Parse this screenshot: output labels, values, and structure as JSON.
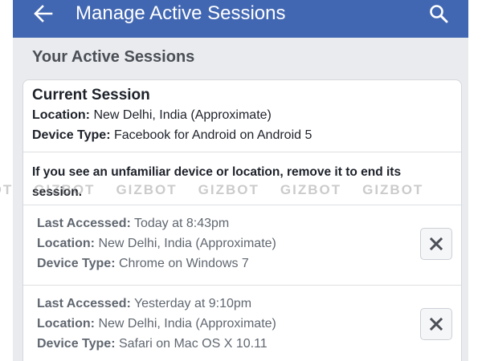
{
  "app_bar": {
    "title": "Manage Active Sessions",
    "back_icon": "arrow-left-icon",
    "search_icon": "search-icon",
    "color": "#4267b2"
  },
  "section_heading": "Your Active Sessions",
  "current_session": {
    "title": "Current Session",
    "location_label": "Location:",
    "location_value": "New Delhi, India (Approximate)",
    "device_label": "Device Type:",
    "device_value": "Facebook for Android on Android 5"
  },
  "warning_text": "If you see an unfamiliar device or location, remove it to end its session.",
  "sessions": [
    {
      "accessed_label": "Last Accessed:",
      "accessed_value": "Today at 8:43pm",
      "location_label": "Location:",
      "location_value": "New Delhi, India (Approximate)",
      "device_label": "Device Type:",
      "device_value": "Chrome on Windows 7"
    },
    {
      "accessed_label": "Last Accessed:",
      "accessed_value": "Yesterday at 9:10pm",
      "location_label": "Location:",
      "location_value": "New Delhi, India (Approximate)",
      "device_label": "Device Type:",
      "device_value": "Safari on Mac OS X 10.11"
    }
  ],
  "remove_icon": "close-x-icon",
  "watermark": {
    "text": "GIZBOT",
    "repeats": [
      "GIZBOT",
      "GIZBOT",
      "GIZBOT",
      "GIZBOT",
      "GIZBOT",
      "GIZBOT"
    ]
  }
}
